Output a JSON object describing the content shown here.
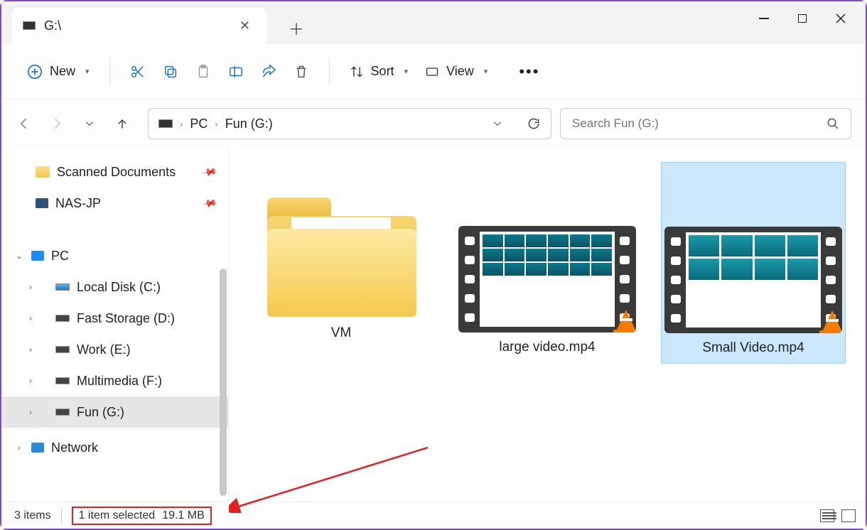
{
  "tab": {
    "title": "G:\\"
  },
  "toolbar": {
    "new": "New",
    "sort": "Sort",
    "view": "View"
  },
  "breadcrumb": {
    "root": "PC",
    "current": "Fun (G:)"
  },
  "search": {
    "placeholder": "Search Fun (G:)"
  },
  "sidebar": {
    "quick": [
      {
        "label": "Scanned Documents",
        "icon": "folder"
      },
      {
        "label": "NAS-JP",
        "icon": "monitor-dark"
      }
    ],
    "pc_label": "PC",
    "drives": [
      {
        "label": "Local Disk (C:)",
        "icon": "drive-blue"
      },
      {
        "label": "Fast Storage (D:)",
        "icon": "drive"
      },
      {
        "label": "Work (E:)",
        "icon": "drive"
      },
      {
        "label": "Multimedia (F:)",
        "icon": "drive"
      },
      {
        "label": "Fun (G:)",
        "icon": "drive",
        "selected": true
      }
    ],
    "network_label": "Network"
  },
  "files": [
    {
      "name": "VM",
      "type": "folder"
    },
    {
      "name": "large video.mp4",
      "type": "video"
    },
    {
      "name": "Small Video.mp4",
      "type": "video",
      "selected": true
    }
  ],
  "status": {
    "count": "3 items",
    "selected": "1 item selected",
    "size": "19.1 MB"
  }
}
